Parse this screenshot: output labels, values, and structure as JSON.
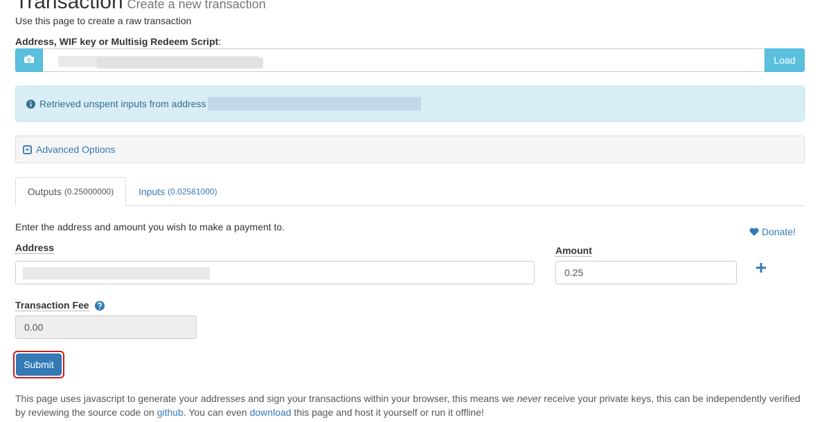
{
  "header": {
    "title": "Transaction",
    "subtitle": "Create a new transaction",
    "intro": "Use this page to create a raw transaction"
  },
  "address_form": {
    "label": "Address, WIF key or Multisig Redeem Script",
    "label_colon": ":",
    "camera_icon": "camera-icon",
    "load_label": "Load"
  },
  "alert": {
    "icon": "info-circle-icon",
    "text": "Retrieved unspent inputs from address"
  },
  "advanced": {
    "icon": "caret-square-down-icon",
    "label": "Advanced Options"
  },
  "tabs": [
    {
      "label": "Outputs",
      "amount": "(0.25000000)"
    },
    {
      "label": "Inputs",
      "amount": "(0.02581000)"
    }
  ],
  "outputs": {
    "instructions": "Enter the address and amount you wish to make a payment to.",
    "donate_label": "Donate!",
    "address_label": "Address",
    "amount_label": "Amount",
    "amount_value": "0.25",
    "add_icon": "plus-icon"
  },
  "fee": {
    "label": "Transaction Fee",
    "value": "0.00",
    "help_icon": "question-circle-icon"
  },
  "submit_label": "Submit",
  "footer": {
    "p1": "This page uses javascript to generate your addresses and sign your transactions within your browser, this means we ",
    "never": "never",
    "p2": " receive your private keys, this can be independently verified by reviewing the source code on ",
    "github": "github",
    "p3": ". You can even ",
    "download": "download",
    "p4": " this page and host it yourself or run it offline!"
  },
  "colors": {
    "primary": "#337ab7",
    "info": "#5bc0de",
    "alert_bg": "#d9edf7",
    "highlight": "#d11a1a"
  }
}
